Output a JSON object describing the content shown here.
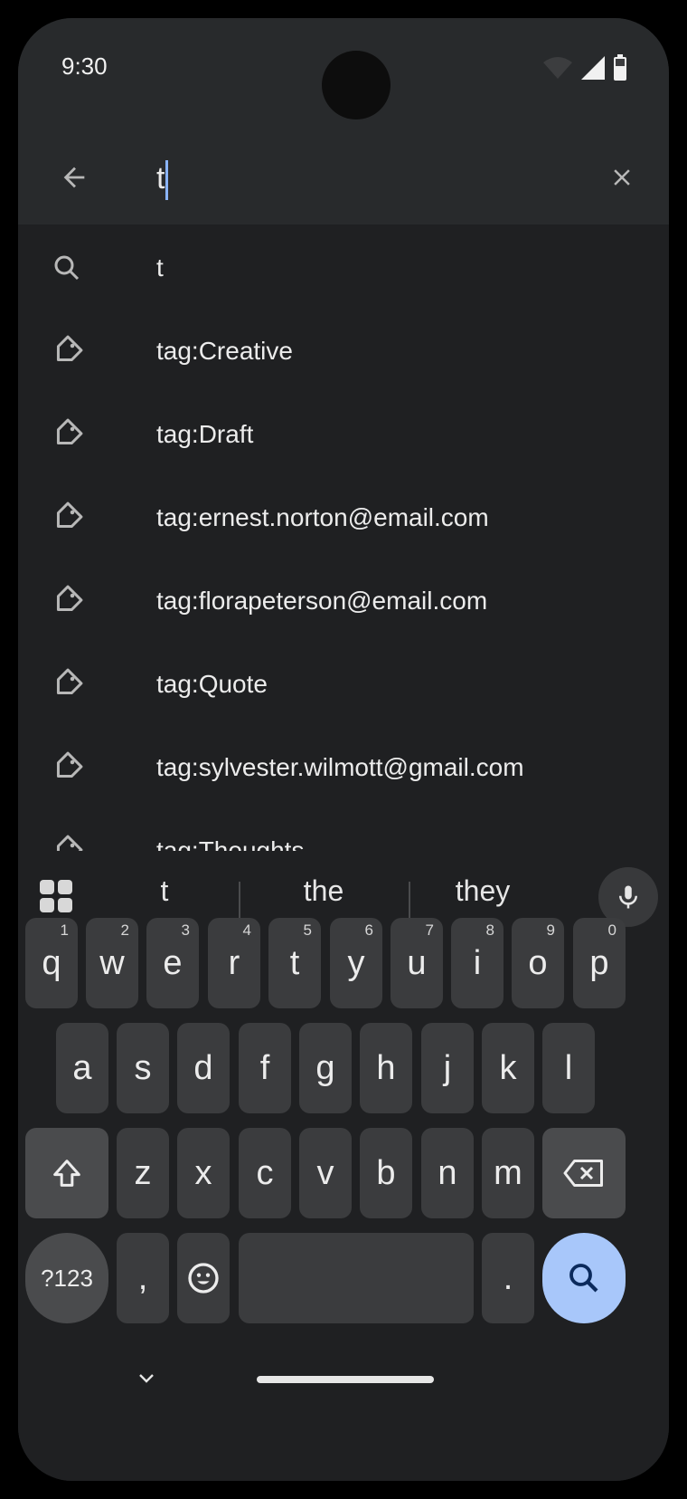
{
  "status": {
    "time": "9:30"
  },
  "search": {
    "value": "t",
    "back_icon": "arrow-back-icon",
    "clear_icon": "close-icon"
  },
  "suggestions": [
    {
      "icon": "search-icon",
      "text": "t"
    },
    {
      "icon": "tag-icon",
      "text": "tag:Creative"
    },
    {
      "icon": "tag-icon",
      "text": "tag:Draft"
    },
    {
      "icon": "tag-icon",
      "text": "tag:ernest.norton@email.com"
    },
    {
      "icon": "tag-icon",
      "text": "tag:florapeterson@email.com"
    },
    {
      "icon": "tag-icon",
      "text": "tag:Quote"
    },
    {
      "icon": "tag-icon",
      "text": "tag:sylvester.wilmott@gmail.com"
    },
    {
      "icon": "tag-icon",
      "text": "tag:Thoughts"
    }
  ],
  "keyboard": {
    "word_suggestions": [
      "t",
      "the",
      "they"
    ],
    "row1": [
      "q",
      "w",
      "e",
      "r",
      "t",
      "y",
      "u",
      "i",
      "o",
      "p"
    ],
    "row1_hints": [
      "1",
      "2",
      "3",
      "4",
      "5",
      "6",
      "7",
      "8",
      "9",
      "0"
    ],
    "row2": [
      "a",
      "s",
      "d",
      "f",
      "g",
      "h",
      "j",
      "k",
      "l"
    ],
    "row3": [
      "z",
      "x",
      "c",
      "v",
      "b",
      "n",
      "m"
    ],
    "symbols_label": "?123",
    "comma_label": ",",
    "period_label": ".",
    "accent_color": "#a8c7fa"
  }
}
